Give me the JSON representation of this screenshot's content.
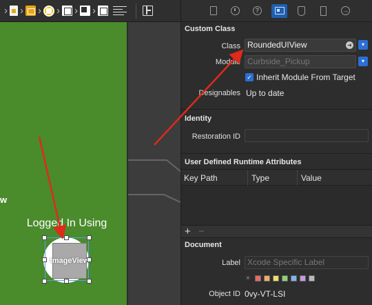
{
  "canvas": {
    "partial_label": "w",
    "logged_label": "Logged In Using",
    "image_label": "ImageView"
  },
  "inspector": {
    "custom_class": {
      "title": "Custom Class",
      "class_label": "Class",
      "class_value": "RoundedUIView",
      "module_label": "Module",
      "module_placeholder": "Curbside_Pickup",
      "inherit_label": "Inherit Module From Target",
      "designables_label": "Designables",
      "designables_value": "Up to date"
    },
    "identity": {
      "title": "Identity",
      "restoration_label": "Restoration ID",
      "restoration_value": ""
    },
    "runtime_attributes": {
      "title": "User Defined Runtime Attributes",
      "columns": [
        "Key Path",
        "Type",
        "Value"
      ],
      "add": "+",
      "remove": "−"
    },
    "document": {
      "title": "Document",
      "label_label": "Label",
      "label_placeholder": "Xcode Specific Label",
      "swatch_clear": "×",
      "swatch_colors": [
        "#e8686a",
        "#f3a96a",
        "#f0db6b",
        "#8fd07a",
        "#7eb4ef",
        "#c59ae0",
        "#b9b9b9"
      ],
      "object_id_label": "Object ID",
      "object_id_value": "0vy-VT-LSI"
    }
  },
  "colors": {
    "canvas_green": "#4a8b2c",
    "arrow_red": "#e02a1a",
    "accent_blue": "#2b6fd6"
  }
}
